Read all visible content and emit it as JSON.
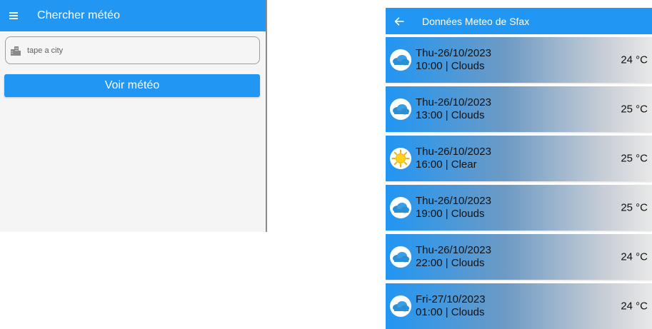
{
  "search_screen": {
    "title": "Chercher météo",
    "city_field": {
      "placeholder": "tape a city",
      "value": ""
    },
    "submit_label": "Voir météo"
  },
  "results_screen": {
    "title": "Données Meteo de Sfax",
    "forecasts": [
      {
        "date": "Thu-26/10/2023",
        "desc": "10:00 | Clouds",
        "temp": "24 °C",
        "icon": "clouds-icon"
      },
      {
        "date": "Thu-26/10/2023",
        "desc": "13:00 | Clouds",
        "temp": "25 °C",
        "icon": "clouds-icon"
      },
      {
        "date": "Thu-26/10/2023",
        "desc": "16:00 | Clear",
        "temp": "25 °C",
        "icon": "sun-icon"
      },
      {
        "date": "Thu-26/10/2023",
        "desc": "19:00 | Clouds",
        "temp": "25 °C",
        "icon": "clouds-icon"
      },
      {
        "date": "Thu-26/10/2023",
        "desc": "22:00 | Clouds",
        "temp": "24 °C",
        "icon": "clouds-icon"
      },
      {
        "date": "Fri-27/10/2023",
        "desc": "01:00 | Clouds",
        "temp": "24 °C",
        "icon": "clouds-icon"
      }
    ]
  },
  "colors": {
    "primary": "#2196f3",
    "card_gradient_end": "#e8e8e8"
  }
}
